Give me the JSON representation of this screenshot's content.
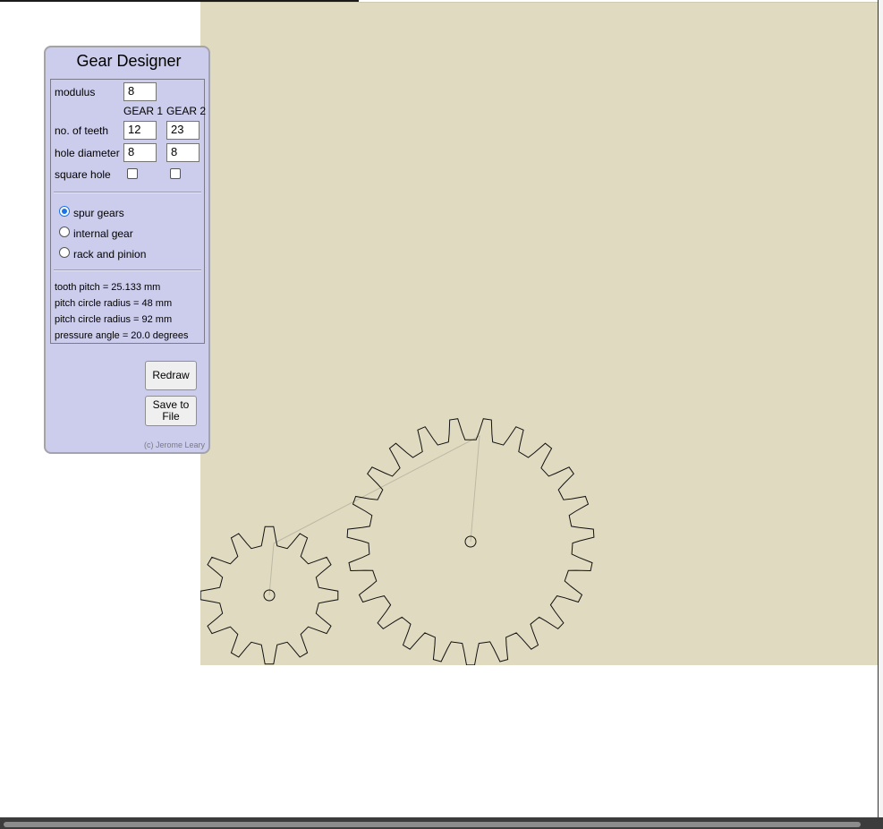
{
  "panel": {
    "title": "Gear Designer",
    "modulus_label": "modulus",
    "modulus_value": "8",
    "gear1_header": "GEAR 1",
    "gear2_header": "GEAR 2",
    "teeth_label": "no. of teeth",
    "teeth_gear1": "12",
    "teeth_gear2": "23",
    "hole_label": "hole diameter",
    "hole_gear1": "8",
    "hole_gear2": "8",
    "square_label": "square hole",
    "square_gear1_checked": false,
    "square_gear2_checked": false,
    "modes": [
      {
        "label": "spur gears",
        "selected": true
      },
      {
        "label": "internal gear",
        "selected": false
      },
      {
        "label": "rack and pinion",
        "selected": false
      }
    ],
    "stats": [
      "tooth pitch = 25.133 mm",
      "pitch circle radius = 48 mm",
      "pitch circle radius = 92 mm",
      "pressure angle = 20.0 degrees"
    ],
    "redraw_label": "Redraw",
    "save_label": "Save to File",
    "credit": "(c) Jerome Leary"
  },
  "colors": {
    "panel_bg": "#ccccec",
    "canvas_bg": "#e0dbc0",
    "gear_stroke": "#111111",
    "link_line": "#bdb8a4",
    "radio_accent": "#1a73e8"
  },
  "gears": [
    {
      "name": "gear-1",
      "teeth": 12
    },
    {
      "name": "gear-2",
      "teeth": 23
    }
  ]
}
